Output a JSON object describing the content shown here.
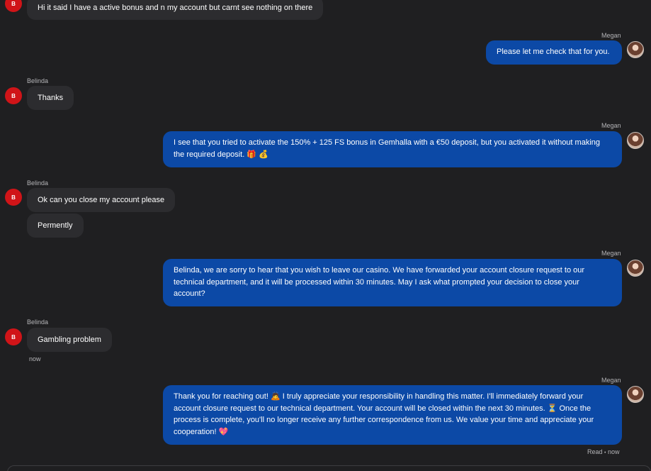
{
  "conversation": {
    "customer": {
      "name": "Belinda",
      "avatar_letter": "B"
    },
    "agent": {
      "name": "Megan"
    },
    "messages": [
      {
        "from": "customer",
        "text": "Hi it said I have a active bonus and n my account but carnt see nothing on there"
      },
      {
        "from": "agent",
        "text": "Please let me check that for you."
      },
      {
        "from": "customer",
        "text": "Thanks"
      },
      {
        "from": "agent",
        "text": "I see that you tried to activate the 150% + 125 FS bonus in Gemhalla with a €50 deposit, but you activated it without making the required deposit. 🎁 💰"
      },
      {
        "from": "customer",
        "text": "Ok can you close my account please"
      },
      {
        "from": "customer",
        "text": "Permently"
      },
      {
        "from": "agent",
        "text": "Belinda, we are sorry to hear that you wish to leave our casino. We have forwarded your account closure request to our technical department, and it will be processed within 30 minutes. May I ask what prompted your decision to close your account?"
      },
      {
        "from": "customer",
        "text": "Gambling problem"
      },
      {
        "from": "agent",
        "text": "Thank you for reaching out! 🙇 I truly appreciate your responsibility in handling this matter. I'll immediately forward your account closure request to our technical department. Your account will be closed within the next 30 minutes. ⏳ Once the process is complete, you'll no longer receive any further correspondence from us. We value your time and appreciate your cooperation! 💖"
      }
    ],
    "customer_timestamp": "now",
    "read_receipt": {
      "status": "Read",
      "separator": "•",
      "time": "now"
    }
  },
  "colors": {
    "background": "#1f1f21",
    "incoming_bubble": "#2c2c2f",
    "outgoing_bubble": "#0c49a6",
    "customer_avatar": "#d01418",
    "meta_text": "#b5b5b8"
  }
}
